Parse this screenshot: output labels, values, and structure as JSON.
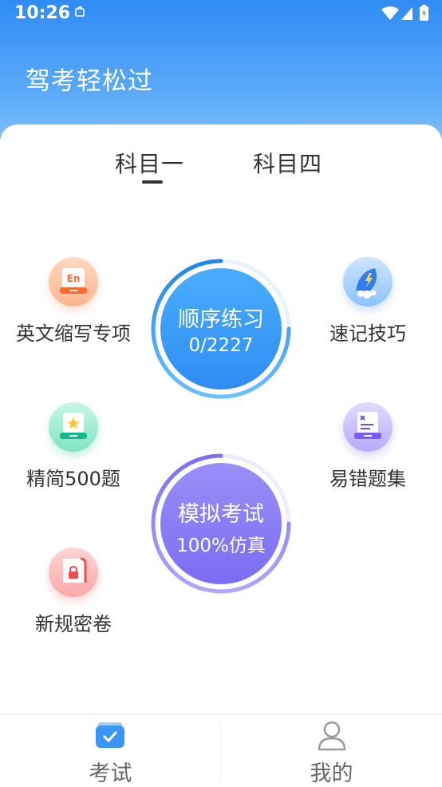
{
  "status_bar": {
    "time": "10:26"
  },
  "header": {
    "title": "驾考轻松过"
  },
  "tabs": [
    {
      "label": "科目一",
      "active": true
    },
    {
      "label": "科目四",
      "active": false
    }
  ],
  "main_buttons": {
    "practice": {
      "title": "顺序练习",
      "progress": "0/2227",
      "done": 0,
      "total": 2227
    },
    "exam": {
      "title": "模拟考试",
      "subtitle": "100%仿真"
    }
  },
  "features": [
    {
      "label": "英文缩写专项",
      "icon": "en-icon",
      "color": "#ff8a4f"
    },
    {
      "label": "速记技巧",
      "icon": "rocket-icon",
      "color": "#4f9cf6"
    },
    {
      "label": "精简500题",
      "icon": "star-book-icon",
      "color": "#25c79c"
    },
    {
      "label": "易错题集",
      "icon": "error-doc-icon",
      "color": "#8d6cf0"
    },
    {
      "label": "新规密卷",
      "icon": "lock-book-icon",
      "color": "#f26a6a"
    }
  ],
  "bottom_nav": [
    {
      "label": "考试",
      "icon": "exam-icon",
      "active": true
    },
    {
      "label": "我的",
      "icon": "user-icon",
      "active": false
    }
  ]
}
